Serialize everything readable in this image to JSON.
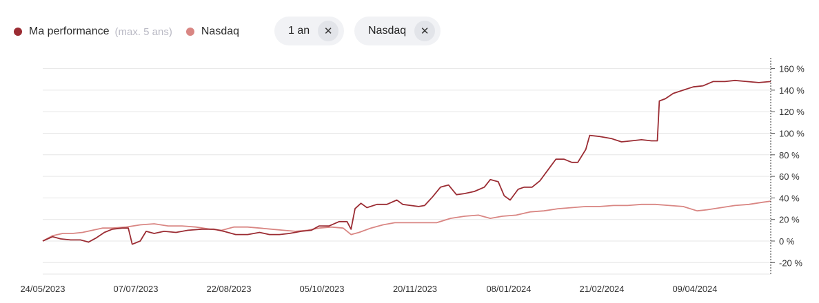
{
  "legend": {
    "series1_label": "Ma performance",
    "series1_note": "(max. 5 ans)",
    "series2_label": "Nasdaq"
  },
  "filters": [
    {
      "label": "1 an",
      "remove": "✕"
    },
    {
      "label": "Nasdaq",
      "remove": "✕"
    }
  ],
  "colors": {
    "series1": "#9b2c33",
    "series2": "#d98683",
    "grid": "#e6e6e6"
  },
  "chart_data": {
    "type": "line",
    "x_ticks": [
      "24/05/2023",
      "07/07/2023",
      "22/08/2023",
      "05/10/2023",
      "20/11/2023",
      "08/01/2024",
      "21/02/2024",
      "09/04/2024"
    ],
    "y_ticks": [
      {
        "value": 160,
        "label": "160 %"
      },
      {
        "value": 140,
        "label": "140 %"
      },
      {
        "value": 120,
        "label": "120 %"
      },
      {
        "value": 100,
        "label": "100 %"
      },
      {
        "value": 80,
        "label": "80 %"
      },
      {
        "value": 60,
        "label": "60 %"
      },
      {
        "value": 40,
        "label": "40 %"
      },
      {
        "value": 20,
        "label": "20 %"
      },
      {
        "value": 0,
        "label": "0 %"
      },
      {
        "value": -20,
        "label": "-20 %"
      }
    ],
    "ylim": [
      -30,
      168
    ],
    "x_range": [
      "2023-05-24",
      "2024-05-24"
    ],
    "series": [
      {
        "name": "Ma performance",
        "points": [
          [
            "2023-05-24",
            0
          ],
          [
            "2023-05-29",
            4
          ],
          [
            "2023-06-02",
            2
          ],
          [
            "2023-06-07",
            1
          ],
          [
            "2023-06-12",
            1
          ],
          [
            "2023-06-16",
            -1
          ],
          [
            "2023-06-20",
            3
          ],
          [
            "2023-06-24",
            8
          ],
          [
            "2023-06-28",
            11
          ],
          [
            "2023-07-03",
            12
          ],
          [
            "2023-07-06",
            12
          ],
          [
            "2023-07-08",
            -3
          ],
          [
            "2023-07-12",
            0
          ],
          [
            "2023-07-15",
            9
          ],
          [
            "2023-07-19",
            7
          ],
          [
            "2023-07-24",
            9
          ],
          [
            "2023-07-30",
            8
          ],
          [
            "2023-08-05",
            10
          ],
          [
            "2023-08-12",
            11
          ],
          [
            "2023-08-18",
            11
          ],
          [
            "2023-08-23",
            9
          ],
          [
            "2023-08-29",
            6
          ],
          [
            "2023-09-04",
            6
          ],
          [
            "2023-09-10",
            8
          ],
          [
            "2023-09-15",
            6
          ],
          [
            "2023-09-20",
            6
          ],
          [
            "2023-09-25",
            7
          ],
          [
            "2023-10-01",
            9
          ],
          [
            "2023-10-06",
            10
          ],
          [
            "2023-10-10",
            14
          ],
          [
            "2023-10-15",
            14
          ],
          [
            "2023-10-20",
            18
          ],
          [
            "2023-10-24",
            18
          ],
          [
            "2023-10-26",
            11
          ],
          [
            "2023-10-28",
            30
          ],
          [
            "2023-10-31",
            35
          ],
          [
            "2023-11-03",
            31
          ],
          [
            "2023-11-08",
            34
          ],
          [
            "2023-11-13",
            34
          ],
          [
            "2023-11-18",
            38
          ],
          [
            "2023-11-21",
            34
          ],
          [
            "2023-11-25",
            33
          ],
          [
            "2023-11-29",
            32
          ],
          [
            "2023-12-02",
            33
          ],
          [
            "2023-12-06",
            41
          ],
          [
            "2023-12-10",
            50
          ],
          [
            "2023-12-14",
            52
          ],
          [
            "2023-12-18",
            43
          ],
          [
            "2023-12-22",
            44
          ],
          [
            "2023-12-27",
            46
          ],
          [
            "2024-01-01",
            50
          ],
          [
            "2024-01-04",
            57
          ],
          [
            "2024-01-08",
            55
          ],
          [
            "2024-01-11",
            42
          ],
          [
            "2024-01-14",
            38
          ],
          [
            "2024-01-18",
            48
          ],
          [
            "2024-01-21",
            50
          ],
          [
            "2024-01-25",
            50
          ],
          [
            "2024-01-29",
            56
          ],
          [
            "2024-02-02",
            66
          ],
          [
            "2024-02-06",
            76
          ],
          [
            "2024-02-10",
            76
          ],
          [
            "2024-02-14",
            73
          ],
          [
            "2024-02-17",
            73
          ],
          [
            "2024-02-21",
            85
          ],
          [
            "2024-02-23",
            98
          ],
          [
            "2024-02-28",
            97
          ],
          [
            "2024-03-05",
            95
          ],
          [
            "2024-03-10",
            92
          ],
          [
            "2024-03-15",
            93
          ],
          [
            "2024-03-20",
            94
          ],
          [
            "2024-03-25",
            93
          ],
          [
            "2024-03-28",
            93
          ],
          [
            "2024-03-29",
            130
          ],
          [
            "2024-04-01",
            132
          ],
          [
            "2024-04-05",
            137
          ],
          [
            "2024-04-10",
            140
          ],
          [
            "2024-04-15",
            143
          ],
          [
            "2024-04-20",
            144
          ],
          [
            "2024-04-25",
            148
          ],
          [
            "2024-05-01",
            148
          ],
          [
            "2024-05-06",
            149
          ],
          [
            "2024-05-12",
            148
          ],
          [
            "2024-05-18",
            147
          ],
          [
            "2024-05-24",
            148
          ]
        ]
      },
      {
        "name": "Nasdaq",
        "points": [
          [
            "2023-05-24",
            0
          ],
          [
            "2023-05-29",
            5
          ],
          [
            "2023-06-03",
            7
          ],
          [
            "2023-06-08",
            7
          ],
          [
            "2023-06-13",
            8
          ],
          [
            "2023-06-18",
            10
          ],
          [
            "2023-06-23",
            12
          ],
          [
            "2023-06-28",
            12
          ],
          [
            "2023-07-05",
            13
          ],
          [
            "2023-07-12",
            15
          ],
          [
            "2023-07-19",
            16
          ],
          [
            "2023-07-26",
            14
          ],
          [
            "2023-08-02",
            14
          ],
          [
            "2023-08-09",
            13
          ],
          [
            "2023-08-16",
            11
          ],
          [
            "2023-08-22",
            10
          ],
          [
            "2023-08-28",
            13
          ],
          [
            "2023-09-04",
            13
          ],
          [
            "2023-09-10",
            12
          ],
          [
            "2023-09-16",
            11
          ],
          [
            "2023-09-22",
            10
          ],
          [
            "2023-09-28",
            9
          ],
          [
            "2023-10-04",
            10
          ],
          [
            "2023-10-10",
            12
          ],
          [
            "2023-10-16",
            13
          ],
          [
            "2023-10-22",
            12
          ],
          [
            "2023-10-26",
            6
          ],
          [
            "2023-10-30",
            8
          ],
          [
            "2023-11-05",
            12
          ],
          [
            "2023-11-11",
            15
          ],
          [
            "2023-11-17",
            17
          ],
          [
            "2023-11-24",
            17
          ],
          [
            "2023-12-01",
            17
          ],
          [
            "2023-12-08",
            17
          ],
          [
            "2023-12-15",
            21
          ],
          [
            "2023-12-22",
            23
          ],
          [
            "2023-12-29",
            24
          ],
          [
            "2024-01-04",
            21
          ],
          [
            "2024-01-10",
            23
          ],
          [
            "2024-01-17",
            24
          ],
          [
            "2024-01-24",
            27
          ],
          [
            "2024-01-31",
            28
          ],
          [
            "2024-02-07",
            30
          ],
          [
            "2024-02-14",
            31
          ],
          [
            "2024-02-21",
            32
          ],
          [
            "2024-02-28",
            32
          ],
          [
            "2024-03-06",
            33
          ],
          [
            "2024-03-13",
            33
          ],
          [
            "2024-03-20",
            34
          ],
          [
            "2024-03-27",
            34
          ],
          [
            "2024-04-03",
            33
          ],
          [
            "2024-04-10",
            32
          ],
          [
            "2024-04-17",
            28
          ],
          [
            "2024-04-22",
            29
          ],
          [
            "2024-04-29",
            31
          ],
          [
            "2024-05-06",
            33
          ],
          [
            "2024-05-13",
            34
          ],
          [
            "2024-05-20",
            36
          ],
          [
            "2024-05-24",
            37
          ]
        ]
      }
    ],
    "grid": true,
    "legend_position": "top-left"
  }
}
